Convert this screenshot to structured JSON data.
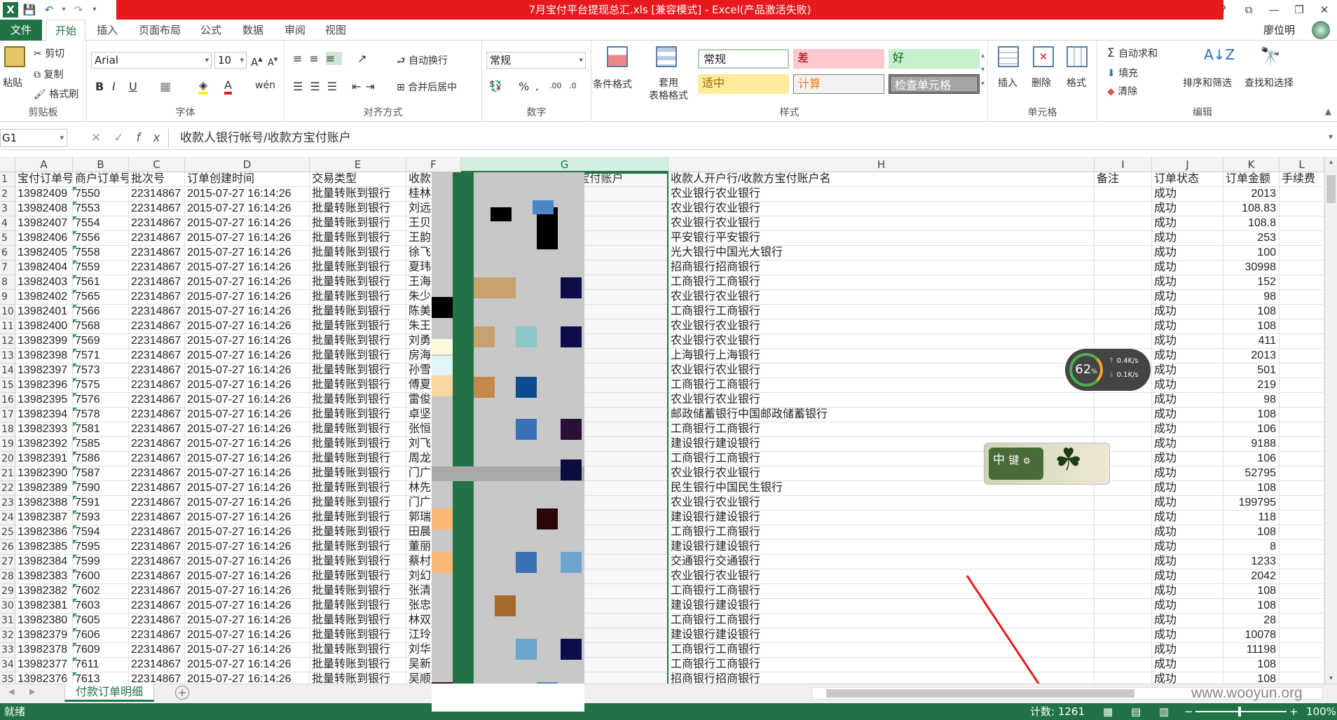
{
  "window": {
    "title": "7月宝付平台提现总汇.xls [兼容模式] - Excel(产品激活失败)",
    "controls": [
      "?",
      "⧉",
      "—",
      "❐",
      "✕"
    ]
  },
  "menu": {
    "tabs": [
      "文件",
      "开始",
      "插入",
      "页面布局",
      "公式",
      "数据",
      "审阅",
      "视图"
    ],
    "user": "廖位明"
  },
  "ribbon": {
    "clipboard": {
      "paste": "粘贴",
      "cut": "剪切",
      "copy": "复制",
      "format_painter": "格式刷",
      "label": "剪贴板"
    },
    "font": {
      "name": "Arial",
      "size": "10",
      "label": "字体"
    },
    "alignment": {
      "wrap": "自动换行",
      "merge": "合并后居中",
      "label": "对齐方式"
    },
    "number": {
      "format": "常规",
      "label": "数字"
    },
    "styles": {
      "conditional": "条件格式",
      "table_format": "套用\n表格格式",
      "cells": [
        "常规",
        "差",
        "好",
        "适中",
        "计算",
        "检查单元格"
      ],
      "label": "样式"
    },
    "cells": {
      "insert": "插入",
      "delete": "删除",
      "format": "格式",
      "label": "单元格"
    },
    "editing": {
      "autosum": "自动求和",
      "fill": "填充",
      "clear": "清除",
      "sort": "排序和筛选",
      "find": "查找和选择",
      "label": "编辑"
    }
  },
  "formula_bar": {
    "name_box": "G1",
    "content": "收款人银行帐号/收款方宝付账户"
  },
  "columns": [
    "A",
    "B",
    "C",
    "D",
    "E",
    "F",
    "G",
    "H",
    "I",
    "J",
    "K",
    "L"
  ],
  "headers": [
    "宝付订单号",
    "商户订单号",
    "批次号",
    "订单创建时间",
    "交易类型",
    "收款人姓名",
    "收款人银行帐号/收款方宝付账户",
    "收款人开户行/收款方宝付账户名",
    "备注",
    "订单状态",
    "订单金额",
    "手续费"
  ],
  "rows": [
    {
      "n": "2",
      "a": "13982409",
      "b": "7550",
      "c": "22314867",
      "d": "2015-07-27 16:14:26",
      "e": "批量转账到银行",
      "f": "桂林",
      "h": "农业银行农业银行",
      "j": "成功",
      "k": "2013"
    },
    {
      "n": "3",
      "a": "13982408",
      "b": "7553",
      "c": "22314867",
      "d": "2015-07-27 16:14:26",
      "e": "批量转账到银行",
      "f": "刘远",
      "h": "农业银行农业银行",
      "j": "成功",
      "k": "108.83"
    },
    {
      "n": "4",
      "a": "13982407",
      "b": "7554",
      "c": "22314867",
      "d": "2015-07-27 16:14:26",
      "e": "批量转账到银行",
      "f": "王贝",
      "h": "农业银行农业银行",
      "j": "成功",
      "k": "108.8"
    },
    {
      "n": "5",
      "a": "13982406",
      "b": "7556",
      "c": "22314867",
      "d": "2015-07-27 16:14:26",
      "e": "批量转账到银行",
      "f": "王韵",
      "h": "平安银行平安银行",
      "j": "成功",
      "k": "253"
    },
    {
      "n": "6",
      "a": "13982405",
      "b": "7558",
      "c": "22314867",
      "d": "2015-07-27 16:14:26",
      "e": "批量转账到银行",
      "f": "徐飞",
      "h": "光大银行中国光大银行",
      "j": "成功",
      "k": "100"
    },
    {
      "n": "7",
      "a": "13982404",
      "b": "7559",
      "c": "22314867",
      "d": "2015-07-27 16:14:26",
      "e": "批量转账到银行",
      "f": "夏玮",
      "h": "招商银行招商银行",
      "j": "成功",
      "k": "30998"
    },
    {
      "n": "8",
      "a": "13982403",
      "b": "7561",
      "c": "22314867",
      "d": "2015-07-27 16:14:26",
      "e": "批量转账到银行",
      "f": "王海",
      "h": "工商银行工商银行",
      "j": "成功",
      "k": "152"
    },
    {
      "n": "9",
      "a": "13982402",
      "b": "7565",
      "c": "22314867",
      "d": "2015-07-27 16:14:26",
      "e": "批量转账到银行",
      "f": "朱少",
      "h": "农业银行农业银行",
      "j": "成功",
      "k": "98"
    },
    {
      "n": "10",
      "a": "13982401",
      "b": "7566",
      "c": "22314867",
      "d": "2015-07-27 16:14:26",
      "e": "批量转账到银行",
      "f": "陈美",
      "h": "工商银行工商银行",
      "j": "成功",
      "k": "108"
    },
    {
      "n": "11",
      "a": "13982400",
      "b": "7568",
      "c": "22314867",
      "d": "2015-07-27 16:14:26",
      "e": "批量转账到银行",
      "f": "朱王",
      "h": "农业银行农业银行",
      "j": "成功",
      "k": "108"
    },
    {
      "n": "12",
      "a": "13982399",
      "b": "7569",
      "c": "22314867",
      "d": "2015-07-27 16:14:26",
      "e": "批量转账到银行",
      "f": "刘勇",
      "h": "农业银行农业银行",
      "j": "成功",
      "k": "411"
    },
    {
      "n": "13",
      "a": "13982398",
      "b": "7571",
      "c": "22314867",
      "d": "2015-07-27 16:14:26",
      "e": "批量转账到银行",
      "f": "房海",
      "h": "上海银行上海银行",
      "j": "成功",
      "k": "2013"
    },
    {
      "n": "14",
      "a": "13982397",
      "b": "7573",
      "c": "22314867",
      "d": "2015-07-27 16:14:26",
      "e": "批量转账到银行",
      "f": "孙雪",
      "h": "农业银行农业银行",
      "j": "成功",
      "k": "501"
    },
    {
      "n": "15",
      "a": "13982396",
      "b": "7575",
      "c": "22314867",
      "d": "2015-07-27 16:14:26",
      "e": "批量转账到银行",
      "f": "傅夏",
      "h": "工商银行工商银行",
      "j": "成功",
      "k": "219"
    },
    {
      "n": "16",
      "a": "13982395",
      "b": "7576",
      "c": "22314867",
      "d": "2015-07-27 16:14:26",
      "e": "批量转账到银行",
      "f": "雷俊",
      "h": "农业银行农业银行",
      "j": "成功",
      "k": "98"
    },
    {
      "n": "17",
      "a": "13982394",
      "b": "7578",
      "c": "22314867",
      "d": "2015-07-27 16:14:26",
      "e": "批量转账到银行",
      "f": "卓坚",
      "h": "邮政储蓄银行中国邮政储蓄银行",
      "j": "成功",
      "k": "108"
    },
    {
      "n": "18",
      "a": "13982393",
      "b": "7581",
      "c": "22314867",
      "d": "2015-07-27 16:14:26",
      "e": "批量转账到银行",
      "f": "张恒",
      "h": "工商银行工商银行",
      "j": "成功",
      "k": "106"
    },
    {
      "n": "19",
      "a": "13982392",
      "b": "7585",
      "c": "22314867",
      "d": "2015-07-27 16:14:26",
      "e": "批量转账到银行",
      "f": "刘飞",
      "h": "建设银行建设银行",
      "j": "成功",
      "k": "9188"
    },
    {
      "n": "20",
      "a": "13982391",
      "b": "7586",
      "c": "22314867",
      "d": "2015-07-27 16:14:26",
      "e": "批量转账到银行",
      "f": "周龙",
      "h": "工商银行工商银行",
      "j": "成功",
      "k": "106"
    },
    {
      "n": "21",
      "a": "13982390",
      "b": "7587",
      "c": "22314867",
      "d": "2015-07-27 16:14:26",
      "e": "批量转账到银行",
      "f": "门广",
      "h": "农业银行农业银行",
      "j": "成功",
      "k": "52795"
    },
    {
      "n": "22",
      "a": "13982389",
      "b": "7590",
      "c": "22314867",
      "d": "2015-07-27 16:14:26",
      "e": "批量转账到银行",
      "f": "林先",
      "h": "民生银行中国民生银行",
      "j": "成功",
      "k": "108"
    },
    {
      "n": "23",
      "a": "13982388",
      "b": "7591",
      "c": "22314867",
      "d": "2015-07-27 16:14:26",
      "e": "批量转账到银行",
      "f": "门广",
      "h": "农业银行农业银行",
      "j": "成功",
      "k": "199795"
    },
    {
      "n": "24",
      "a": "13982387",
      "b": "7593",
      "c": "22314867",
      "d": "2015-07-27 16:14:26",
      "e": "批量转账到银行",
      "f": "郭瑞",
      "h": "建设银行建设银行",
      "j": "成功",
      "k": "118"
    },
    {
      "n": "25",
      "a": "13982386",
      "b": "7594",
      "c": "22314867",
      "d": "2015-07-27 16:14:26",
      "e": "批量转账到银行",
      "f": "田晨",
      "h": "工商银行工商银行",
      "j": "成功",
      "k": "108"
    },
    {
      "n": "26",
      "a": "13982385",
      "b": "7595",
      "c": "22314867",
      "d": "2015-07-27 16:14:26",
      "e": "批量转账到银行",
      "f": "董丽",
      "h": "建设银行建设银行",
      "j": "成功",
      "k": "8"
    },
    {
      "n": "27",
      "a": "13982384",
      "b": "7599",
      "c": "22314867",
      "d": "2015-07-27 16:14:26",
      "e": "批量转账到银行",
      "f": "蔡村",
      "h": "交通银行交通银行",
      "j": "成功",
      "k": "1233"
    },
    {
      "n": "28",
      "a": "13982383",
      "b": "7600",
      "c": "22314867",
      "d": "2015-07-27 16:14:26",
      "e": "批量转账到银行",
      "f": "刘幻",
      "h": "农业银行农业银行",
      "j": "成功",
      "k": "2042"
    },
    {
      "n": "29",
      "a": "13982382",
      "b": "7602",
      "c": "22314867",
      "d": "2015-07-27 16:14:26",
      "e": "批量转账到银行",
      "f": "张清",
      "h": "工商银行工商银行",
      "j": "成功",
      "k": "108"
    },
    {
      "n": "30",
      "a": "13982381",
      "b": "7603",
      "c": "22314867",
      "d": "2015-07-27 16:14:26",
      "e": "批量转账到银行",
      "f": "张忠",
      "h": "建设银行建设银行",
      "j": "成功",
      "k": "108"
    },
    {
      "n": "31",
      "a": "13982380",
      "b": "7605",
      "c": "22314867",
      "d": "2015-07-27 16:14:26",
      "e": "批量转账到银行",
      "f": "林双",
      "h": "工商银行工商银行",
      "j": "成功",
      "k": "28"
    },
    {
      "n": "32",
      "a": "13982379",
      "b": "7606",
      "c": "22314867",
      "d": "2015-07-27 16:14:26",
      "e": "批量转账到银行",
      "f": "江玲",
      "h": "建设银行建设银行",
      "j": "成功",
      "k": "10078"
    },
    {
      "n": "33",
      "a": "13982378",
      "b": "7609",
      "c": "22314867",
      "d": "2015-07-27 16:14:26",
      "e": "批量转账到银行",
      "f": "刘华",
      "h": "工商银行工商银行",
      "j": "成功",
      "k": "11198"
    },
    {
      "n": "34",
      "a": "13982377",
      "b": "7611",
      "c": "22314867",
      "d": "2015-07-27 16:14:26",
      "e": "批量转账到银行",
      "f": "吴新",
      "h": "工商银行工商银行",
      "j": "成功",
      "k": "108"
    },
    {
      "n": "35",
      "a": "13982376",
      "b": "7613",
      "c": "22314867",
      "d": "2015-07-27 16:14:26",
      "e": "批量转账到银行",
      "f": "吴顺",
      "h": "招商银行招商银行",
      "j": "成功",
      "k": "108"
    }
  ],
  "sheet_tab": "付款订单明细",
  "status": {
    "ready": "就绪",
    "count": "计数: 1261",
    "zoom": "100%"
  },
  "speed_widget": {
    "percent": "62",
    "up": "0.4K/s",
    "down": "0.1K/s"
  },
  "ime_widget": {
    "chars": [
      "中",
      "键"
    ]
  },
  "watermark": "www.wooyun.org",
  "colors": {
    "excel_green": "#217346",
    "title_red": "#e8191d",
    "annotation_arrow": "#e8191d"
  }
}
